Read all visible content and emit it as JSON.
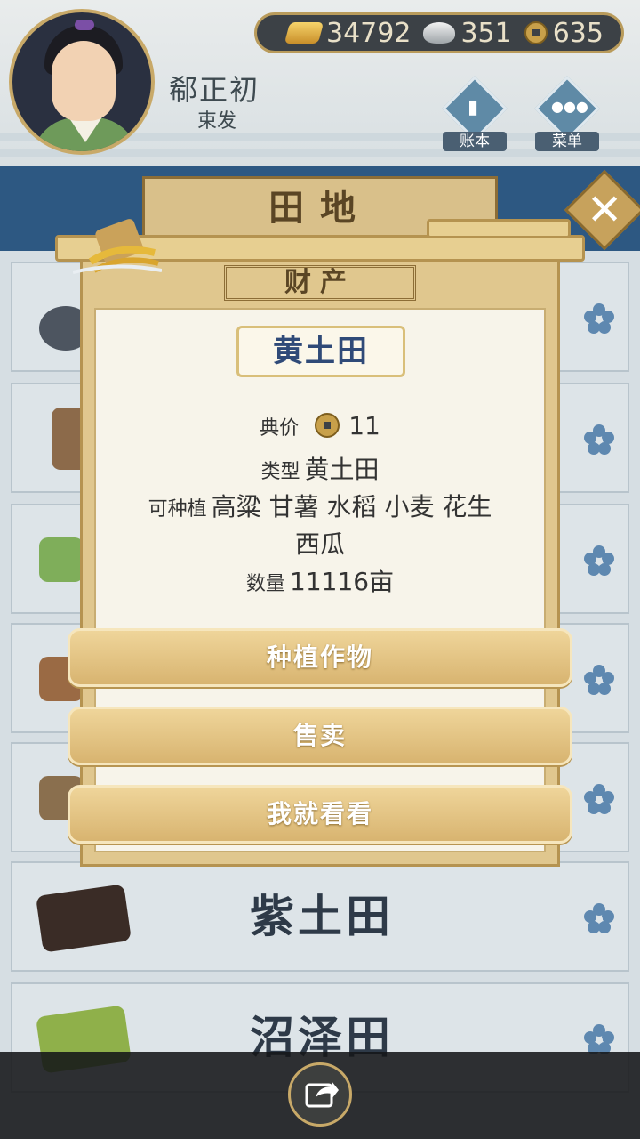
{
  "player": {
    "name": "郗正初",
    "title": "束发"
  },
  "currency": [
    {
      "icon": "gold-ingot-icon",
      "value": "34792"
    },
    {
      "icon": "silver-ingot-icon",
      "value": "351"
    },
    {
      "icon": "copper-coin-icon",
      "value": "635"
    }
  ],
  "header_buttons": {
    "ledger_label": "账本",
    "menu_label": "菜单"
  },
  "page": {
    "title": "田地"
  },
  "land_list": [
    {
      "label": "紫土田"
    },
    {
      "label": "沼泽田"
    }
  ],
  "modal": {
    "header": "财产",
    "item_name": "黄土田",
    "price_key": "典价",
    "price_value": "11",
    "type_key": "类型",
    "type_value": "黄土田",
    "plantable_key": "可种植",
    "plantable_value_line1": "高粱 甘薯 水稻 小麦 花生",
    "plantable_value_line2": "西瓜",
    "quantity_key": "数量",
    "quantity_value": "11116亩",
    "buttons": {
      "plant": "种植作物",
      "sell": "售卖",
      "browse": "我就看看"
    }
  },
  "colors": {
    "accent_blue": "#2d5882",
    "modal_gold": "#e0c78e",
    "button_gold": "#d8b470",
    "item_name_blue": "#2f4a78"
  }
}
